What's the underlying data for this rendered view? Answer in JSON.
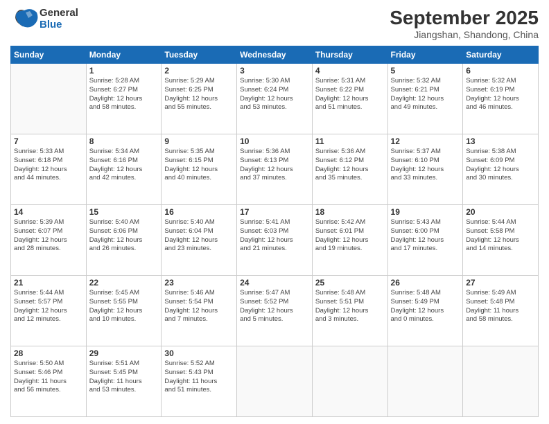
{
  "logo": {
    "general": "General",
    "blue": "Blue"
  },
  "header": {
    "title": "September 2025",
    "subtitle": "Jiangshan, Shandong, China"
  },
  "days_of_week": [
    "Sunday",
    "Monday",
    "Tuesday",
    "Wednesday",
    "Thursday",
    "Friday",
    "Saturday"
  ],
  "weeks": [
    [
      {
        "day": "",
        "info": ""
      },
      {
        "day": "1",
        "info": "Sunrise: 5:28 AM\nSunset: 6:27 PM\nDaylight: 12 hours\nand 58 minutes."
      },
      {
        "day": "2",
        "info": "Sunrise: 5:29 AM\nSunset: 6:25 PM\nDaylight: 12 hours\nand 55 minutes."
      },
      {
        "day": "3",
        "info": "Sunrise: 5:30 AM\nSunset: 6:24 PM\nDaylight: 12 hours\nand 53 minutes."
      },
      {
        "day": "4",
        "info": "Sunrise: 5:31 AM\nSunset: 6:22 PM\nDaylight: 12 hours\nand 51 minutes."
      },
      {
        "day": "5",
        "info": "Sunrise: 5:32 AM\nSunset: 6:21 PM\nDaylight: 12 hours\nand 49 minutes."
      },
      {
        "day": "6",
        "info": "Sunrise: 5:32 AM\nSunset: 6:19 PM\nDaylight: 12 hours\nand 46 minutes."
      }
    ],
    [
      {
        "day": "7",
        "info": "Sunrise: 5:33 AM\nSunset: 6:18 PM\nDaylight: 12 hours\nand 44 minutes."
      },
      {
        "day": "8",
        "info": "Sunrise: 5:34 AM\nSunset: 6:16 PM\nDaylight: 12 hours\nand 42 minutes."
      },
      {
        "day": "9",
        "info": "Sunrise: 5:35 AM\nSunset: 6:15 PM\nDaylight: 12 hours\nand 40 minutes."
      },
      {
        "day": "10",
        "info": "Sunrise: 5:36 AM\nSunset: 6:13 PM\nDaylight: 12 hours\nand 37 minutes."
      },
      {
        "day": "11",
        "info": "Sunrise: 5:36 AM\nSunset: 6:12 PM\nDaylight: 12 hours\nand 35 minutes."
      },
      {
        "day": "12",
        "info": "Sunrise: 5:37 AM\nSunset: 6:10 PM\nDaylight: 12 hours\nand 33 minutes."
      },
      {
        "day": "13",
        "info": "Sunrise: 5:38 AM\nSunset: 6:09 PM\nDaylight: 12 hours\nand 30 minutes."
      }
    ],
    [
      {
        "day": "14",
        "info": "Sunrise: 5:39 AM\nSunset: 6:07 PM\nDaylight: 12 hours\nand 28 minutes."
      },
      {
        "day": "15",
        "info": "Sunrise: 5:40 AM\nSunset: 6:06 PM\nDaylight: 12 hours\nand 26 minutes."
      },
      {
        "day": "16",
        "info": "Sunrise: 5:40 AM\nSunset: 6:04 PM\nDaylight: 12 hours\nand 23 minutes."
      },
      {
        "day": "17",
        "info": "Sunrise: 5:41 AM\nSunset: 6:03 PM\nDaylight: 12 hours\nand 21 minutes."
      },
      {
        "day": "18",
        "info": "Sunrise: 5:42 AM\nSunset: 6:01 PM\nDaylight: 12 hours\nand 19 minutes."
      },
      {
        "day": "19",
        "info": "Sunrise: 5:43 AM\nSunset: 6:00 PM\nDaylight: 12 hours\nand 17 minutes."
      },
      {
        "day": "20",
        "info": "Sunrise: 5:44 AM\nSunset: 5:58 PM\nDaylight: 12 hours\nand 14 minutes."
      }
    ],
    [
      {
        "day": "21",
        "info": "Sunrise: 5:44 AM\nSunset: 5:57 PM\nDaylight: 12 hours\nand 12 minutes."
      },
      {
        "day": "22",
        "info": "Sunrise: 5:45 AM\nSunset: 5:55 PM\nDaylight: 12 hours\nand 10 minutes."
      },
      {
        "day": "23",
        "info": "Sunrise: 5:46 AM\nSunset: 5:54 PM\nDaylight: 12 hours\nand 7 minutes."
      },
      {
        "day": "24",
        "info": "Sunrise: 5:47 AM\nSunset: 5:52 PM\nDaylight: 12 hours\nand 5 minutes."
      },
      {
        "day": "25",
        "info": "Sunrise: 5:48 AM\nSunset: 5:51 PM\nDaylight: 12 hours\nand 3 minutes."
      },
      {
        "day": "26",
        "info": "Sunrise: 5:48 AM\nSunset: 5:49 PM\nDaylight: 12 hours\nand 0 minutes."
      },
      {
        "day": "27",
        "info": "Sunrise: 5:49 AM\nSunset: 5:48 PM\nDaylight: 11 hours\nand 58 minutes."
      }
    ],
    [
      {
        "day": "28",
        "info": "Sunrise: 5:50 AM\nSunset: 5:46 PM\nDaylight: 11 hours\nand 56 minutes."
      },
      {
        "day": "29",
        "info": "Sunrise: 5:51 AM\nSunset: 5:45 PM\nDaylight: 11 hours\nand 53 minutes."
      },
      {
        "day": "30",
        "info": "Sunrise: 5:52 AM\nSunset: 5:43 PM\nDaylight: 11 hours\nand 51 minutes."
      },
      {
        "day": "",
        "info": ""
      },
      {
        "day": "",
        "info": ""
      },
      {
        "day": "",
        "info": ""
      },
      {
        "day": "",
        "info": ""
      }
    ]
  ]
}
